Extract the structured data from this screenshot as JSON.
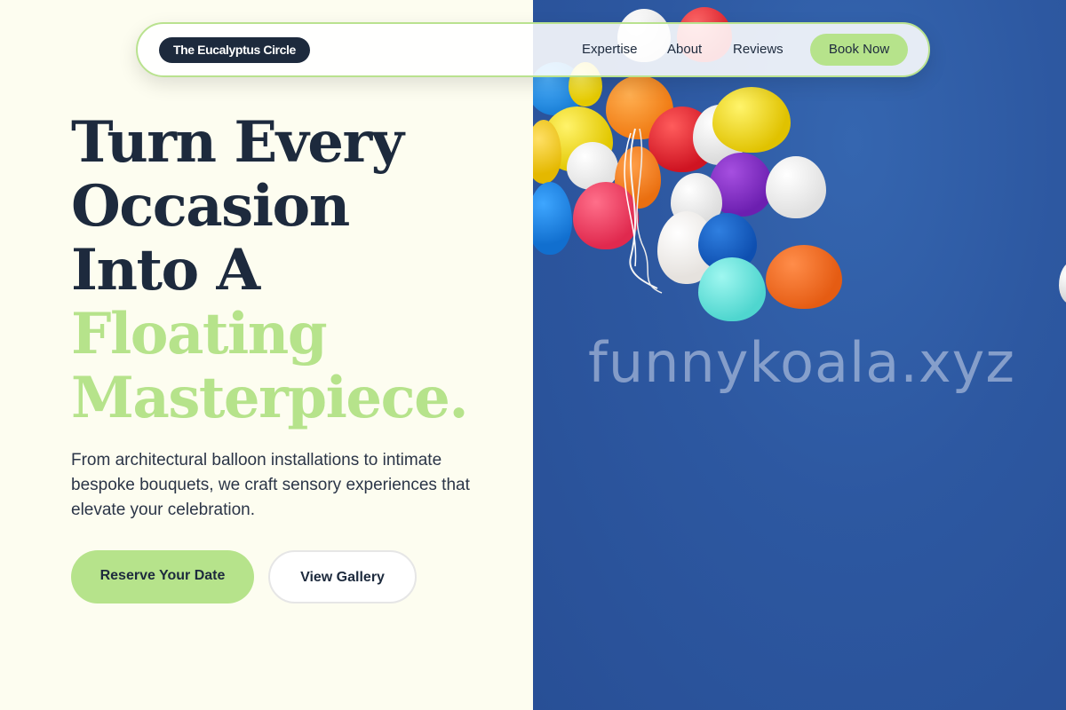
{
  "nav": {
    "brand": "The Eucalyptus Circle",
    "links": [
      "Expertise",
      "About",
      "Reviews"
    ],
    "cta": "Book Now"
  },
  "hero": {
    "headline_dark": [
      "Turn Every",
      "Occasion",
      "Into A"
    ],
    "headline_green": [
      "Floating",
      "Masterpiece."
    ],
    "subtext": "From architectural balloon installations to intimate bespoke bouquets, we craft sensory experiences that elevate your celebration.",
    "primary_cta": "Reserve Your Date",
    "secondary_cta": "View Gallery"
  },
  "image": {
    "watermark": "funnykoala.xyz"
  },
  "colors": {
    "accent_green": "#b6e38b",
    "navy": "#1d2a3d",
    "cream": "#fdfdf0",
    "sky_blue": "#2d58a1"
  }
}
